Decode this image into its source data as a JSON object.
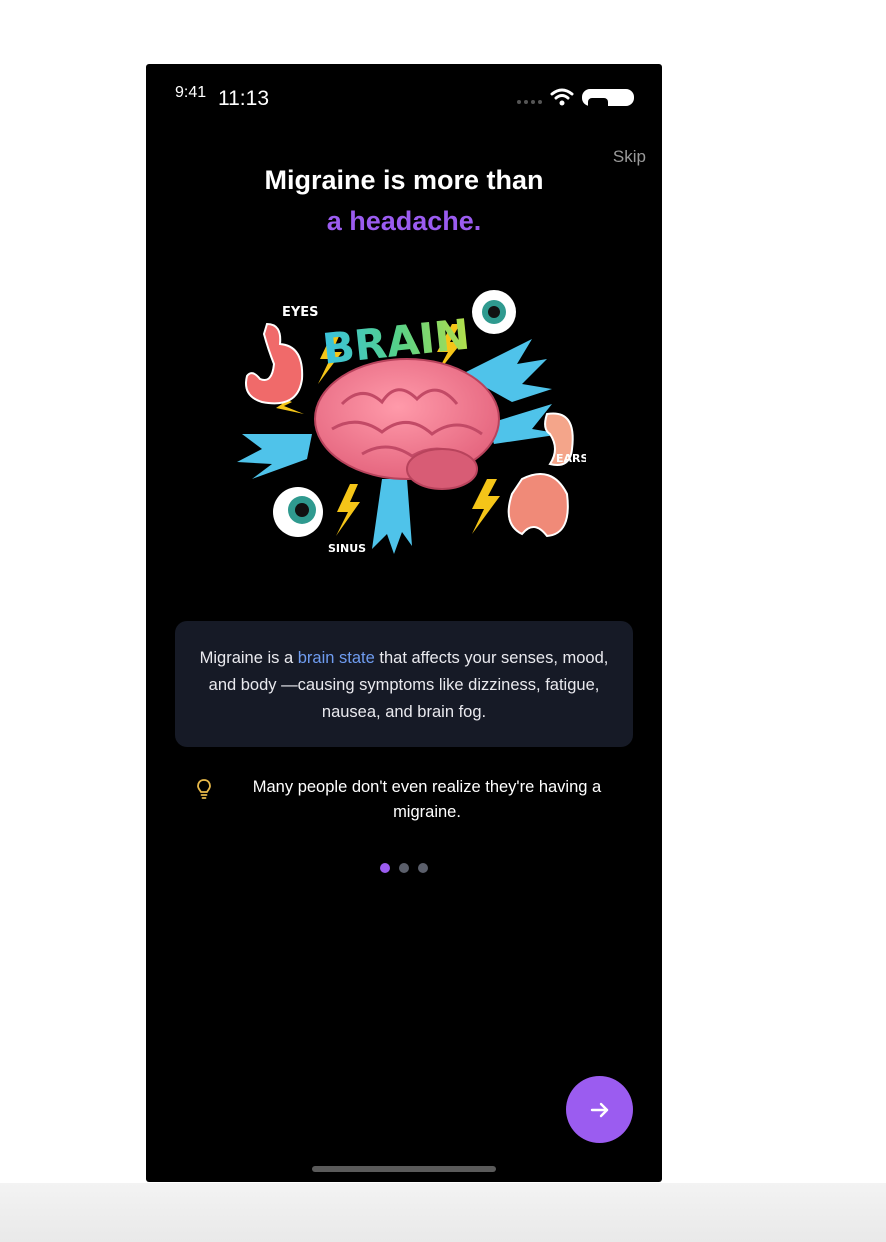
{
  "status_bar": {
    "time_small": "9:41",
    "time": "11:13"
  },
  "skip_label": "Skip",
  "headline": {
    "line1": "Migraine is more than",
    "line2": "a headache."
  },
  "illustration": {
    "labels": {
      "brain": "BRAIN",
      "eyes": "EYES",
      "ears": "EARS",
      "sinus": "SINUS"
    }
  },
  "info_card": {
    "text_before": "Migraine is a ",
    "highlight": "brain state",
    "text_after": " that affects your senses, mood, and body —causing symptoms like dizziness, fatigue, nausea, and brain fog."
  },
  "tip": {
    "icon": "lightbulb-icon",
    "text": "Many people don't even realize they're having a migraine."
  },
  "pagination": {
    "total": 3,
    "active_index": 0
  },
  "next_button": {
    "icon": "arrow-right-icon"
  },
  "colors": {
    "accent": "#9b5cf0",
    "highlight_blue": "#6f9cf0",
    "card_bg": "#161a26",
    "dot_inactive": "#5b5f6b",
    "tip_icon": "#e8b94a"
  }
}
